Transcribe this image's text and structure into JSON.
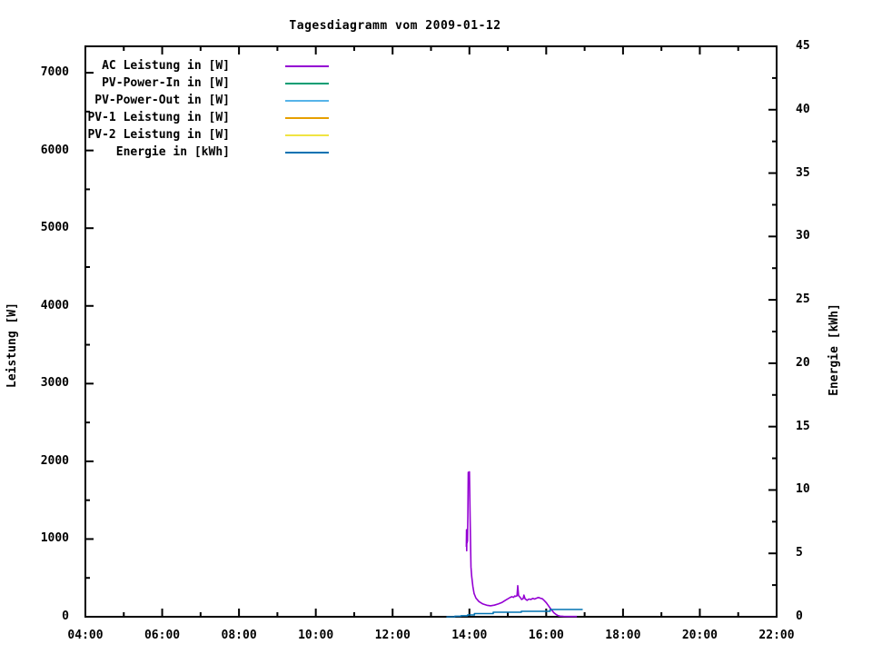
{
  "chart_data": {
    "type": "line",
    "title": "Tagesdiagramm vom 2009-01-12",
    "background_color": "#ffffff",
    "grid": false,
    "legend_position": "top-left-inside",
    "x_axis": {
      "range_hours": [
        4,
        22
      ],
      "major_ticks": [
        {
          "hour": 4,
          "label": "04:00"
        },
        {
          "hour": 6,
          "label": "06:00"
        },
        {
          "hour": 8,
          "label": "08:00"
        },
        {
          "hour": 10,
          "label": "10:00"
        },
        {
          "hour": 12,
          "label": "12:00"
        },
        {
          "hour": 14,
          "label": "14:00"
        },
        {
          "hour": 16,
          "label": "16:00"
        },
        {
          "hour": 18,
          "label": "18:00"
        },
        {
          "hour": 20,
          "label": "20:00"
        },
        {
          "hour": 22,
          "label": "22:00"
        }
      ],
      "minor_tick_hours": [
        5,
        7,
        9,
        11,
        13,
        15,
        17,
        19,
        21
      ]
    },
    "y_left": {
      "label": "Leistung [W]",
      "range": [
        0,
        7340
      ],
      "major_ticks": [
        {
          "value": 0,
          "label": "0"
        },
        {
          "value": 1000,
          "label": "1000"
        },
        {
          "value": 2000,
          "label": "2000"
        },
        {
          "value": 3000,
          "label": "3000"
        },
        {
          "value": 4000,
          "label": "4000"
        },
        {
          "value": 5000,
          "label": "5000"
        },
        {
          "value": 6000,
          "label": "6000"
        },
        {
          "value": 7000,
          "label": "7000"
        }
      ],
      "minor_tick_values": [
        500,
        1500,
        2500,
        3500,
        4500,
        5500,
        6500
      ]
    },
    "y_right": {
      "label": "Energie [kWh]",
      "range": [
        0,
        45
      ],
      "major_ticks": [
        {
          "value": 0,
          "label": "0"
        },
        {
          "value": 5,
          "label": "5"
        },
        {
          "value": 10,
          "label": "10"
        },
        {
          "value": 15,
          "label": "15"
        },
        {
          "value": 20,
          "label": "20"
        },
        {
          "value": 25,
          "label": "25"
        },
        {
          "value": 30,
          "label": "30"
        },
        {
          "value": 35,
          "label": "35"
        },
        {
          "value": 40,
          "label": "40"
        },
        {
          "value": 45,
          "label": "45"
        }
      ],
      "minor_tick_values": [
        2.5,
        7.5,
        12.5,
        17.5,
        22.5,
        27.5,
        32.5,
        37.5,
        42.5
      ]
    },
    "series": [
      {
        "name": "AC Leistung in [W]",
        "color": "#9400d3",
        "axis": "left",
        "style": "line",
        "points": [
          [
            13.92,
            900
          ],
          [
            13.925,
            1120
          ],
          [
            13.93,
            850
          ],
          [
            13.935,
            1070
          ],
          [
            13.94,
            950
          ],
          [
            13.95,
            980
          ],
          [
            13.96,
            1310
          ],
          [
            13.97,
            1860
          ],
          [
            13.99,
            1845
          ],
          [
            14.0,
            1865
          ],
          [
            14.02,
            1250
          ],
          [
            14.04,
            640
          ],
          [
            14.06,
            520
          ],
          [
            14.09,
            390
          ],
          [
            14.12,
            300
          ],
          [
            14.17,
            240
          ],
          [
            14.25,
            195
          ],
          [
            14.35,
            165
          ],
          [
            14.45,
            148
          ],
          [
            14.55,
            142
          ],
          [
            14.65,
            150
          ],
          [
            14.75,
            165
          ],
          [
            14.85,
            185
          ],
          [
            14.95,
            215
          ],
          [
            15.05,
            245
          ],
          [
            15.1,
            258
          ],
          [
            15.15,
            250
          ],
          [
            15.18,
            268
          ],
          [
            15.2,
            262
          ],
          [
            15.24,
            270
          ],
          [
            15.26,
            400
          ],
          [
            15.28,
            272
          ],
          [
            15.32,
            250
          ],
          [
            15.36,
            222
          ],
          [
            15.4,
            235
          ],
          [
            15.42,
            278
          ],
          [
            15.45,
            232
          ],
          [
            15.5,
            212
          ],
          [
            15.55,
            228
          ],
          [
            15.6,
            222
          ],
          [
            15.65,
            236
          ],
          [
            15.7,
            228
          ],
          [
            15.76,
            242
          ],
          [
            15.8,
            248
          ],
          [
            15.85,
            238
          ],
          [
            15.9,
            232
          ],
          [
            15.95,
            208
          ],
          [
            16.0,
            182
          ],
          [
            16.05,
            148
          ],
          [
            16.1,
            112
          ],
          [
            16.15,
            82
          ],
          [
            16.2,
            52
          ],
          [
            16.25,
            32
          ],
          [
            16.3,
            16
          ],
          [
            16.36,
            8
          ],
          [
            16.45,
            5
          ],
          [
            16.6,
            4
          ],
          [
            16.8,
            3
          ]
        ]
      },
      {
        "name": "PV-Power-In in [W]",
        "color": "#009e73",
        "axis": "left",
        "style": "line",
        "points": []
      },
      {
        "name": "PV-Power-Out in [W]",
        "color": "#56b4e9",
        "axis": "left",
        "style": "line",
        "points": []
      },
      {
        "name": "PV-1 Leistung in [W]",
        "color": "#e69f00",
        "axis": "left",
        "style": "line",
        "points": []
      },
      {
        "name": "PV-2 Leistung in [W]",
        "color": "#f0e442",
        "axis": "left",
        "style": "line",
        "points": []
      },
      {
        "name": "Energie in [kWh]",
        "color": "#0072b2",
        "axis": "right",
        "style": "step",
        "points": [
          [
            13.4,
            0.0
          ],
          [
            13.62,
            0.04
          ],
          [
            13.78,
            0.08
          ],
          [
            13.95,
            0.14
          ],
          [
            14.13,
            0.25
          ],
          [
            14.62,
            0.36
          ],
          [
            15.35,
            0.43
          ],
          [
            16.1,
            0.57
          ],
          [
            16.95,
            0.57
          ]
        ]
      }
    ]
  }
}
